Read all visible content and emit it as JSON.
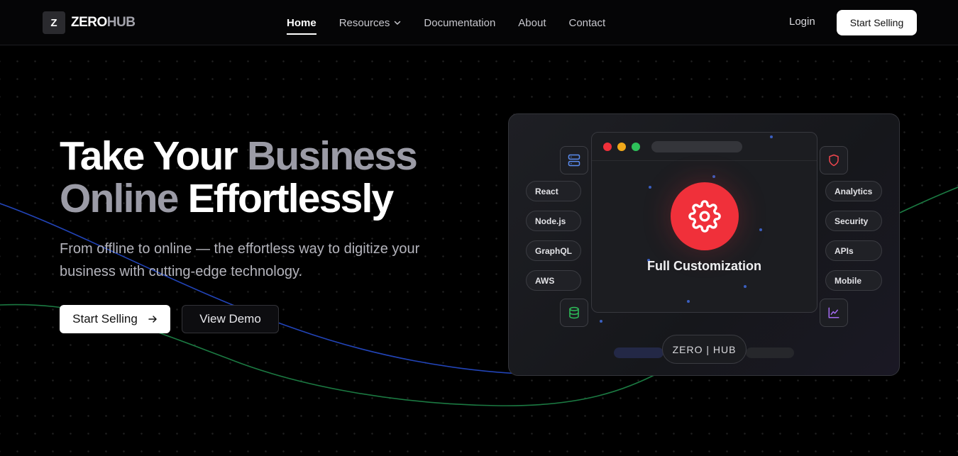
{
  "brand": {
    "logo_letter": "Z",
    "name_part1": "ZERO",
    "name_part2": "HUB"
  },
  "nav": {
    "items": [
      {
        "label": "Home",
        "active": true
      },
      {
        "label": "Resources",
        "dropdown": true
      },
      {
        "label": "Documentation"
      },
      {
        "label": "About"
      },
      {
        "label": "Contact"
      }
    ],
    "login_label": "Login",
    "cta_label": "Start Selling"
  },
  "hero": {
    "title_w1": "Take Your",
    "title_g1": "Business",
    "title_g2": "Online",
    "title_w2": "Effortlessly",
    "subtitle": "From offline to online — the effortless way to digitize your business with cutting-edge technology.",
    "primary_button": "Start Selling",
    "secondary_button": "View Demo"
  },
  "card": {
    "center_label": "Full Customization",
    "left_pills": [
      "React",
      "Node.js",
      "GraphQL",
      "AWS"
    ],
    "right_pills": [
      "Analytics",
      "Security",
      "APIs",
      "Mobile"
    ],
    "footer_badge": "ZERO | HUB"
  },
  "colors": {
    "accent_red": "#f0303a",
    "traffic_red": "#f0303a",
    "traffic_yellow": "#f0a81a",
    "traffic_green": "#2ec15a",
    "line_blue": "#2244b8",
    "line_green": "#1b7a42"
  },
  "icons": [
    "chevron-down-icon",
    "arrow-right-icon",
    "server-icon",
    "shield-icon",
    "database-icon",
    "chart-line-icon",
    "gear-icon"
  ]
}
